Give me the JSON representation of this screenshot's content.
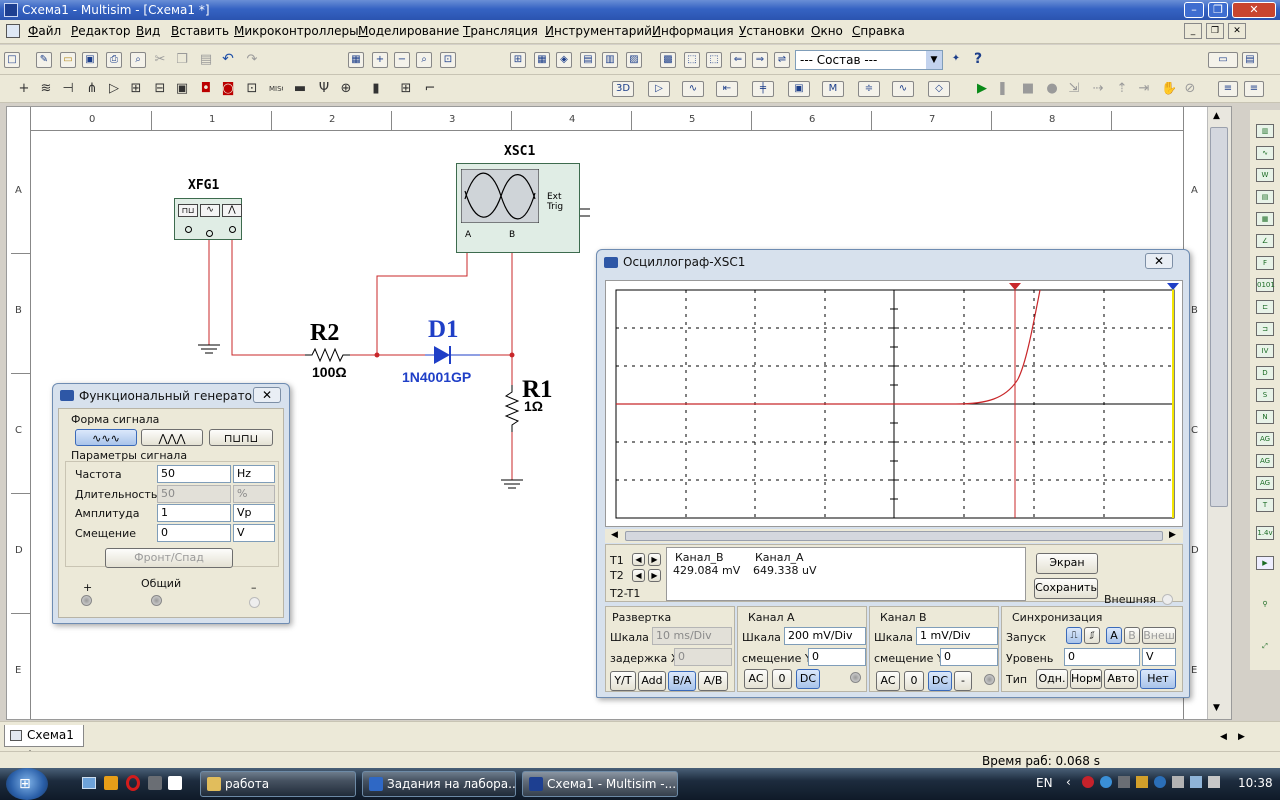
{
  "window": {
    "title": "Схема1 - Multisim - [Схема1 *]"
  },
  "menu": [
    "Файл",
    "Редактор",
    "Вид",
    "Вставить",
    "Микроконтроллеры",
    "Моделирование",
    "Трансляция",
    "Инструментарий",
    "Информация",
    "Установки",
    "Окно",
    "Справка"
  ],
  "toolbar": {
    "dropdown_value": "--- Состав ---"
  },
  "ruler": {
    "columns": [
      "0",
      "1",
      "2",
      "3",
      "4",
      "5",
      "6",
      "7",
      "8"
    ],
    "rows": [
      "A",
      "B",
      "C",
      "D",
      "E"
    ]
  },
  "schematic": {
    "xfg_label": "XFG1",
    "xsc_label": "XSC1",
    "ext_trig": "Ext Trig",
    "chan_a": "A",
    "chan_b": "B",
    "r2_ref": "R2",
    "r2_value": "100Ω",
    "d1_ref": "D1",
    "d1_model": "1N4001GP",
    "r1_ref": "R1",
    "r1_value": "1Ω"
  },
  "func_gen": {
    "title": "Функциональный генерато...",
    "waveform_group": "Форма сигнала",
    "params_group": "Параметры сигнала",
    "rows": [
      {
        "label": "Частота",
        "value": "50",
        "unit": "Hz",
        "disabled": false
      },
      {
        "label": "Длительность",
        "value": "50",
        "unit": "%",
        "disabled": true
      },
      {
        "label": "Амплитуда",
        "value": "1",
        "unit": "Vp",
        "disabled": false
      },
      {
        "label": "Смещение",
        "value": "0",
        "unit": "V",
        "disabled": false
      }
    ],
    "edge_button": "Фронт/Спад",
    "terminal_plus": "+",
    "terminal_common": "Общий",
    "terminal_minus": "–"
  },
  "scope": {
    "title": "Осциллограф-XSC1",
    "t1": "T1",
    "t2": "T2",
    "t2t1": "T2-T1",
    "col_b": "Канал_B",
    "col_a": "Канал_A",
    "val_b": "429.084 mV",
    "val_a": "649.338 uV",
    "btn_screen": "Экран",
    "btn_save": "Сохранить",
    "external": "Внешняя",
    "timebase": {
      "title": "Развертка",
      "scale_label": "Шкала",
      "scale": "10 ms/Div",
      "xpos_label": "задержка X",
      "xpos": "0",
      "buttons": [
        "Y/T",
        "Add",
        "B/A",
        "A/B"
      ]
    },
    "channel_a": {
      "title": "Канал А",
      "scale_label": "Шкала",
      "scale": "200 mV/Div",
      "ypos_label": "смещение Y",
      "ypos": "0",
      "buttons": [
        "AC",
        "0",
        "DC"
      ]
    },
    "channel_b": {
      "title": "Канал В",
      "scale_label": "Шкала",
      "scale": "1 mV/Div",
      "ypos_label": "смещение Y",
      "ypos": "0",
      "buttons": [
        "AC",
        "0",
        "DC",
        "-"
      ]
    },
    "trigger": {
      "title": "Синхронизация",
      "edge_label": "Запуск",
      "level_label": "Уровень",
      "level": "0",
      "level_unit": "V",
      "type_label": "Тип",
      "src_buttons": [
        "A",
        "B",
        "Внеш"
      ],
      "type_buttons": [
        "Одн.",
        "Норм",
        "Авто",
        "Нет"
      ]
    }
  },
  "tabs": {
    "sheet": "Схема1 *"
  },
  "status": {
    "runtime": "Время раб: 0.068 s"
  },
  "taskbar": {
    "items": [
      "работа",
      "Задания на лабора...",
      "Схема1 - Multisim -..."
    ],
    "lang": "EN",
    "clock": "10:38"
  }
}
